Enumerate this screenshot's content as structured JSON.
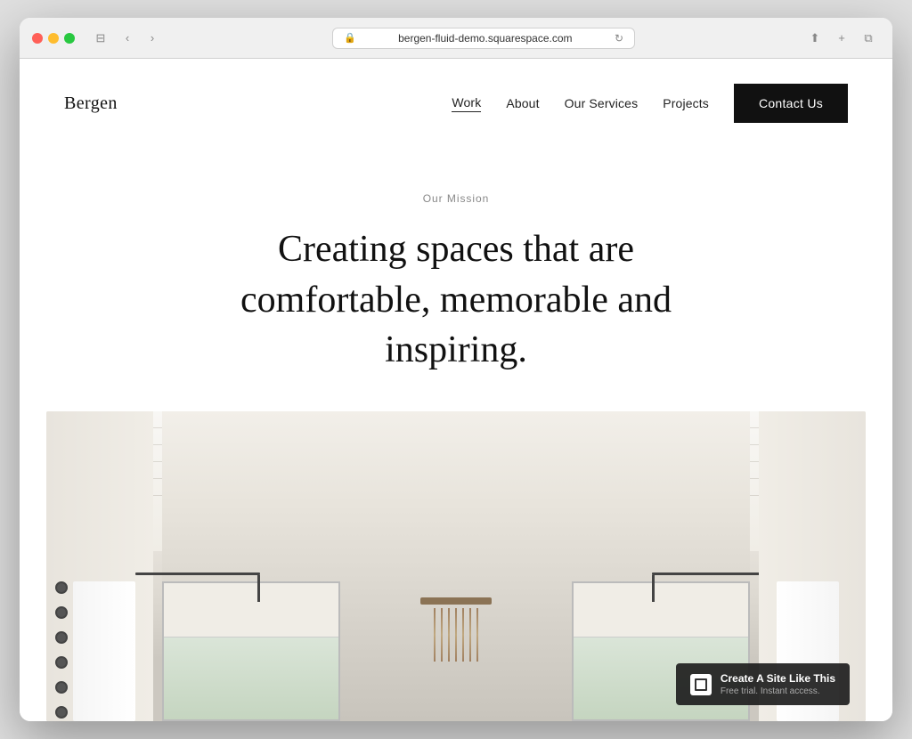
{
  "browser": {
    "url": "bergen-fluid-demo.squarespace.com",
    "back_label": "‹",
    "forward_label": "›",
    "refresh_label": "↻",
    "share_label": "⬆",
    "new_tab_label": "+",
    "windows_label": "⧉",
    "sidebar_label": "⊟"
  },
  "site": {
    "logo": "Bergen",
    "nav": {
      "items": [
        {
          "label": "Work",
          "active": true
        },
        {
          "label": "About",
          "active": false
        },
        {
          "label": "Our Services",
          "active": false
        },
        {
          "label": "Projects",
          "active": false
        }
      ],
      "cta_label": "Contact Us"
    },
    "hero": {
      "label": "Our Mission",
      "title": "Creating spaces that are comfortable, memorable and inspiring."
    },
    "badge": {
      "title": "Create A Site Like This",
      "subtitle": "Free trial. Instant access."
    }
  }
}
